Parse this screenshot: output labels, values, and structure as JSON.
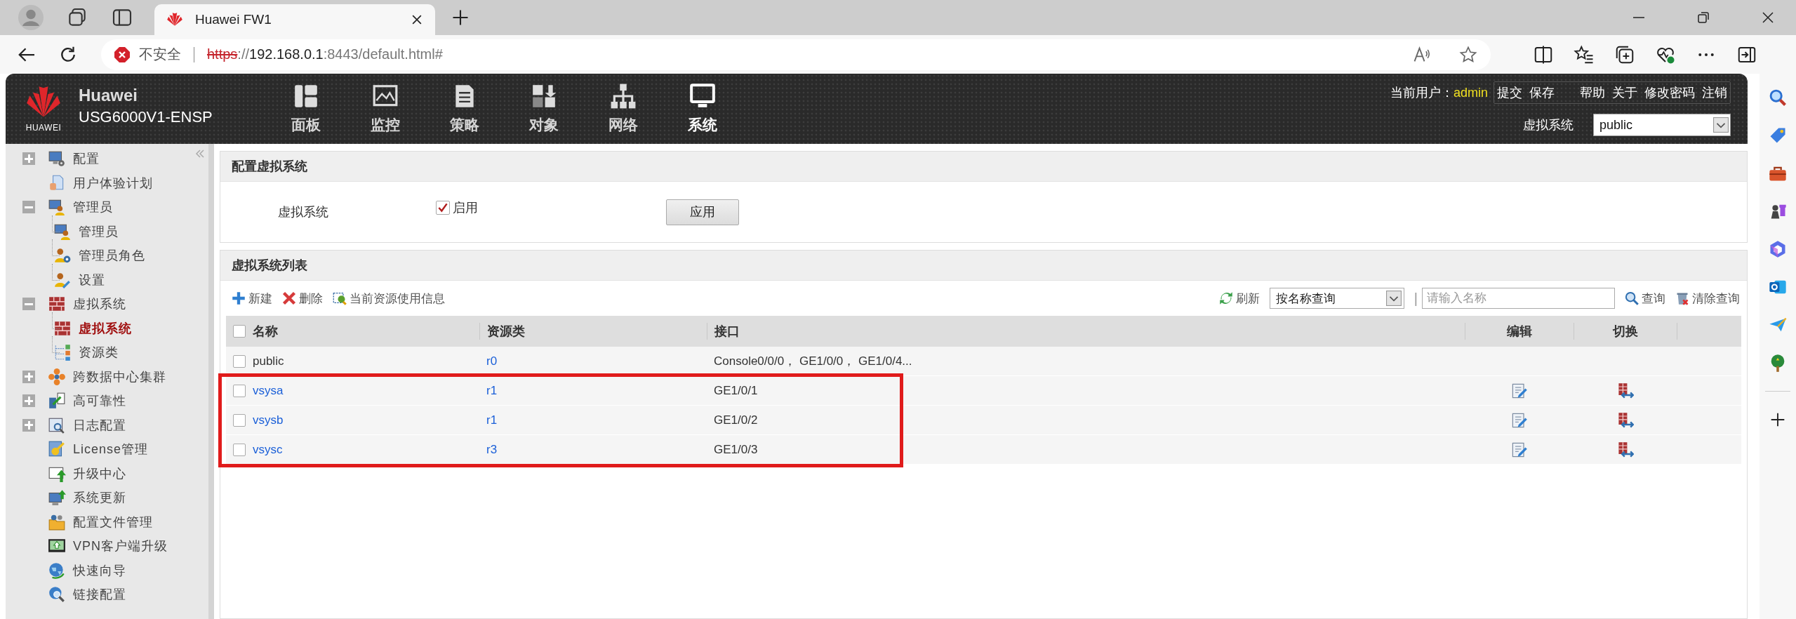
{
  "browser": {
    "tab_title": "Huawei FW1",
    "security_label": "不安全",
    "url_parts": [
      {
        "text": "https",
        "kind": "insecure-scheme"
      },
      {
        "text": "://",
        "kind": "muted"
      },
      {
        "text": "192.168.0.1",
        "kind": "host"
      },
      {
        "text": ":8443/default.html#",
        "kind": "muted"
      }
    ]
  },
  "header": {
    "brand": {
      "logo_text": "HUAWEI",
      "name": "Huawei",
      "model": "USG6000V1-ENSP"
    },
    "nav": [
      {
        "label": "面板",
        "selected": false
      },
      {
        "label": "监控",
        "selected": false
      },
      {
        "label": "策略",
        "selected": false
      },
      {
        "label": "对象",
        "selected": false
      },
      {
        "label": "网络",
        "selected": false
      },
      {
        "label": "系统",
        "selected": true
      }
    ],
    "user_label": "当前用户：",
    "user_name": "admin",
    "actions": [
      "提交",
      "保存",
      "帮助",
      "关于",
      "修改密码",
      "注销"
    ],
    "vsys_label": "虚拟系统",
    "vsys_value": "public"
  },
  "sidebar": {
    "items": [
      {
        "label": "配置",
        "expanded": false,
        "selected": false
      },
      {
        "label": "用户体验计划",
        "selected": false
      },
      {
        "label": "管理员",
        "expanded": true,
        "selected": false,
        "children": [
          {
            "label": "管理员",
            "selected": false
          },
          {
            "label": "管理员角色",
            "selected": false
          },
          {
            "label": "设置",
            "selected": false
          }
        ]
      },
      {
        "label": "虚拟系统",
        "expanded": true,
        "selected": false,
        "children": [
          {
            "label": "虚拟系统",
            "selected": true
          },
          {
            "label": "资源类",
            "selected": false
          }
        ]
      },
      {
        "label": "跨数据中心集群",
        "expanded": false,
        "selected": false
      },
      {
        "label": "高可靠性",
        "expanded": false,
        "selected": false
      },
      {
        "label": "日志配置",
        "expanded": false,
        "selected": false
      },
      {
        "label": "License管理",
        "selected": false
      },
      {
        "label": "升级中心",
        "selected": false
      },
      {
        "label": "系统更新",
        "selected": false
      },
      {
        "label": "配置文件管理",
        "selected": false
      },
      {
        "label": "VPN客户端升级",
        "selected": false
      },
      {
        "label": "快速向导",
        "selected": false
      },
      {
        "label": "链接配置",
        "selected": false
      }
    ]
  },
  "config_panel": {
    "title": "配置虚拟系统",
    "field_label": "虚拟系统",
    "enable_label": "启用",
    "enabled": true,
    "apply_button": "应用"
  },
  "list_panel": {
    "title": "虚拟系统列表",
    "toolbar": [
      "新建",
      "删除",
      "当前资源使用信息"
    ],
    "refresh_label": "刷新",
    "query_mode": "按名称查询",
    "separator": "|",
    "search_placeholder": "请输入名称",
    "query_label": "查询",
    "clear_label": "清除查询",
    "table": {
      "select_all_checked": false,
      "columns": [
        "名称",
        "资源类",
        "接口",
        "编辑",
        "切换"
      ],
      "rows": [
        {
          "name": "public",
          "kind": "plain",
          "resource_class": "r0",
          "interfaces": "Console0/0/0， GE1/0/0， GE1/0/4...",
          "actions": false,
          "checked": false,
          "highlighted": false
        },
        {
          "name": "vsysa",
          "kind": "link",
          "resource_class": "r1",
          "interfaces": "GE1/0/1",
          "actions": true,
          "checked": false,
          "highlighted": true
        },
        {
          "name": "vsysb",
          "kind": "link",
          "resource_class": "r1",
          "interfaces": "GE1/0/2",
          "actions": true,
          "checked": false,
          "highlighted": true
        },
        {
          "name": "vsysc",
          "kind": "link",
          "resource_class": "r3",
          "interfaces": "GE1/0/3",
          "actions": true,
          "checked": false,
          "highlighted": true
        }
      ]
    }
  }
}
